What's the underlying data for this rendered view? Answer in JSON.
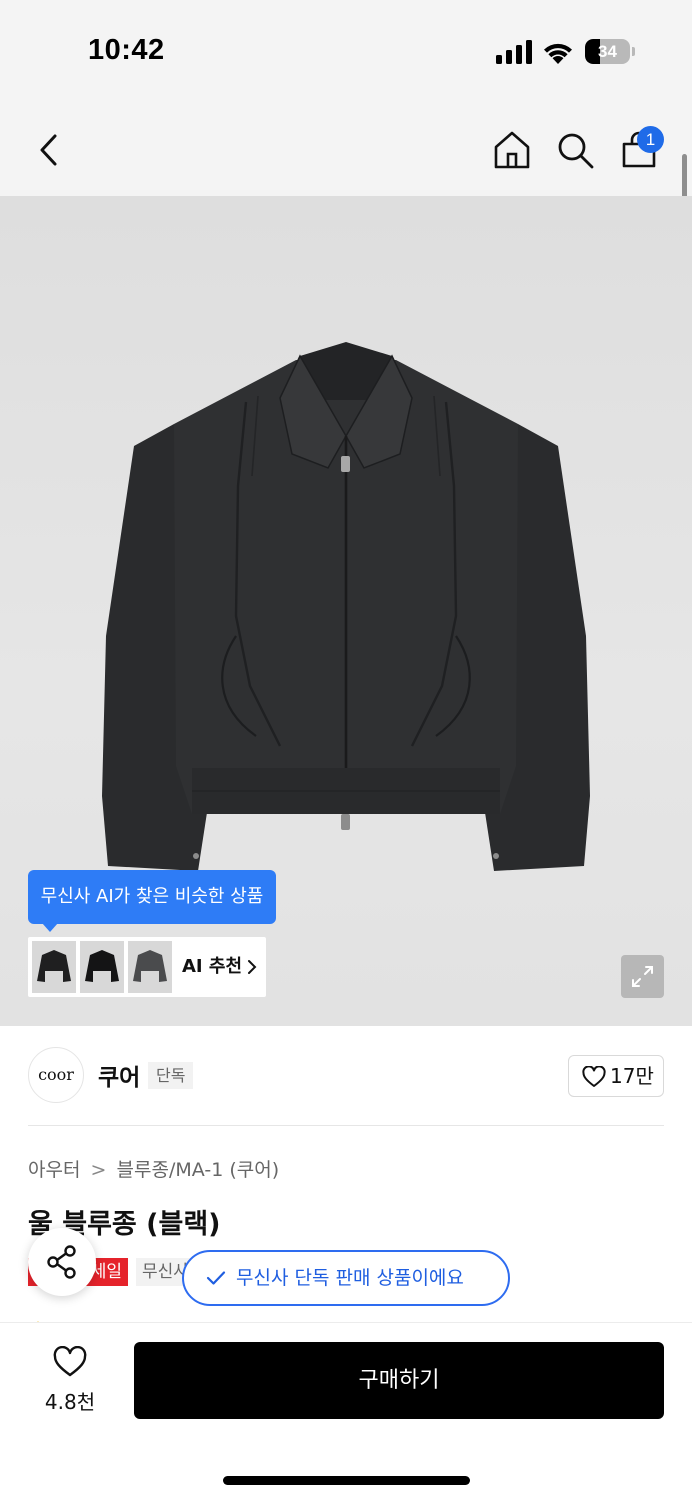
{
  "status_bar": {
    "time": "10:42",
    "battery_level": 34,
    "battery_text": "34"
  },
  "nav": {
    "cart_count": "1",
    "icons": [
      "chevron-left-icon",
      "home-icon",
      "search-icon",
      "shopping-bag-icon"
    ]
  },
  "hero": {
    "ai_tooltip": "무신사 AI가 찾은 비슷한 상품",
    "ai_recommend_label": "AI 추천",
    "thumbnails": [
      "similar-jacket-1",
      "similar-jacket-2",
      "similar-jacket-3"
    ]
  },
  "brand": {
    "logo_text": "coor",
    "name": "쿠어",
    "badge": "단독",
    "likes": "17만"
  },
  "product": {
    "breadcrumb": [
      "아우터",
      "블루종/MA-1 (쿠어)"
    ],
    "breadcrumb_separator": ">",
    "title": "울 블루종 (블랙)",
    "sale_tag": "세일",
    "exclusive_tag": "무신사",
    "exclusive_toast": "무신사 단독 판매 상품이에요"
  },
  "bottom_bar": {
    "wishlist_count": "4.8천",
    "buy_label": "구매하기"
  },
  "colors": {
    "accent_blue": "#2e7cf6",
    "sale_red": "#e5232b",
    "buy_black": "#000000"
  }
}
